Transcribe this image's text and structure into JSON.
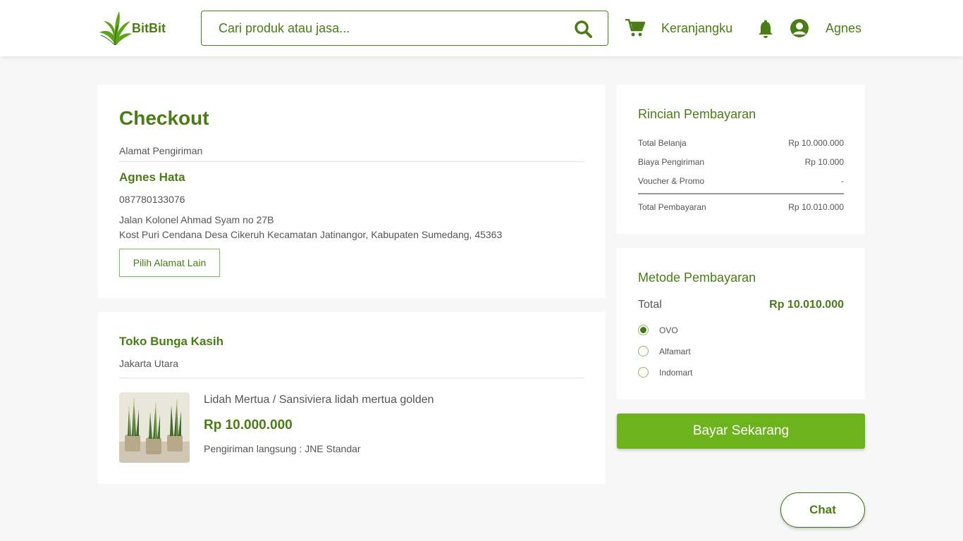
{
  "header": {
    "logo_text": "BitBit",
    "search_placeholder": "Cari produk atau jasa...",
    "cart_label": "Keranjangku",
    "user_name": "Agnes"
  },
  "checkout": {
    "title": "Checkout",
    "address_heading": "Alamat Pengiriman",
    "recipient_name": "Agnes Hata",
    "phone": "087780133076",
    "street": "Jalan Kolonel Ahmad Syam no 27B",
    "address_detail": "Kost Puri Cendana Desa Cikeruh Kecamatan Jatinangor, Kabupaten Sumedang, 45363",
    "choose_address_label": "Pilih Alamat Lain"
  },
  "store": {
    "name": "Toko Bunga Kasih",
    "city": "Jakarta Utara",
    "product": {
      "name": "Lidah Mertua / Sansiviera lidah mertua golden",
      "price": "Rp 10.000.000",
      "shipping": "Pengiriman langsung : JNE Standar"
    }
  },
  "summary": {
    "title": "Rincian Pembayaran",
    "rows": [
      {
        "label": "Total Belanja",
        "value": "Rp 10.000.000"
      },
      {
        "label": "Biaya Pengiriman",
        "value": "Rp 10.000"
      },
      {
        "label": "Voucher & Promo",
        "value": "-"
      }
    ],
    "total_label": "Total Pembayaran",
    "total_value": "Rp 10.010.000"
  },
  "payment_method": {
    "title": "Metode Pembayaran",
    "total_label": "Total",
    "total_value": "Rp 10.010.000",
    "options": [
      {
        "label": "OVO",
        "selected": true
      },
      {
        "label": "Alfamart",
        "selected": false
      },
      {
        "label": "Indomart",
        "selected": false
      }
    ]
  },
  "actions": {
    "pay_label": "Bayar Sekarang",
    "chat_label": "Chat"
  },
  "colors": {
    "brand": "#4a7d14",
    "accent": "#6cb31d",
    "background": "#f7f7f7"
  },
  "icons": [
    "leaf-logo-icon",
    "search-icon",
    "cart-icon",
    "bell-icon",
    "user-avatar-icon"
  ]
}
